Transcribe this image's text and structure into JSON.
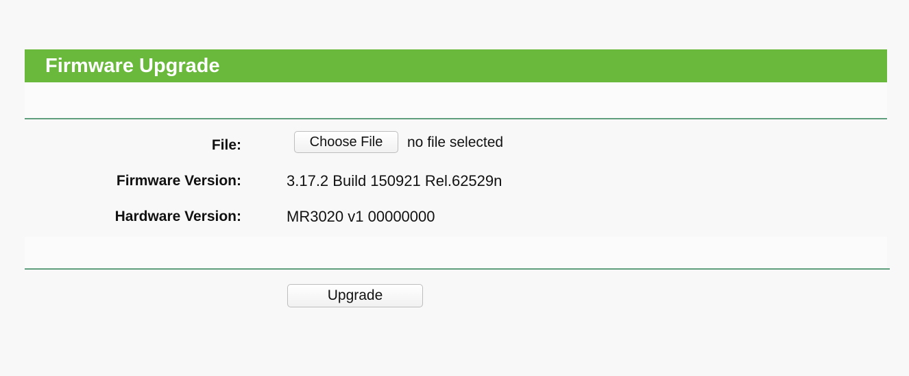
{
  "header": {
    "title": "Firmware Upgrade",
    "background_color": "#6ab93d",
    "text_color": "#ffffff"
  },
  "divider_color": "#5f9e7d",
  "form": {
    "file_label": "File:",
    "choose_file_label": "Choose File",
    "file_status": "no file selected",
    "firmware_version_label": "Firmware Version:",
    "firmware_version_value": "3.17.2 Build 150921 Rel.62529n",
    "hardware_version_label": "Hardware Version:",
    "hardware_version_value": "MR3020 v1 00000000"
  },
  "actions": {
    "upgrade_label": "Upgrade"
  }
}
